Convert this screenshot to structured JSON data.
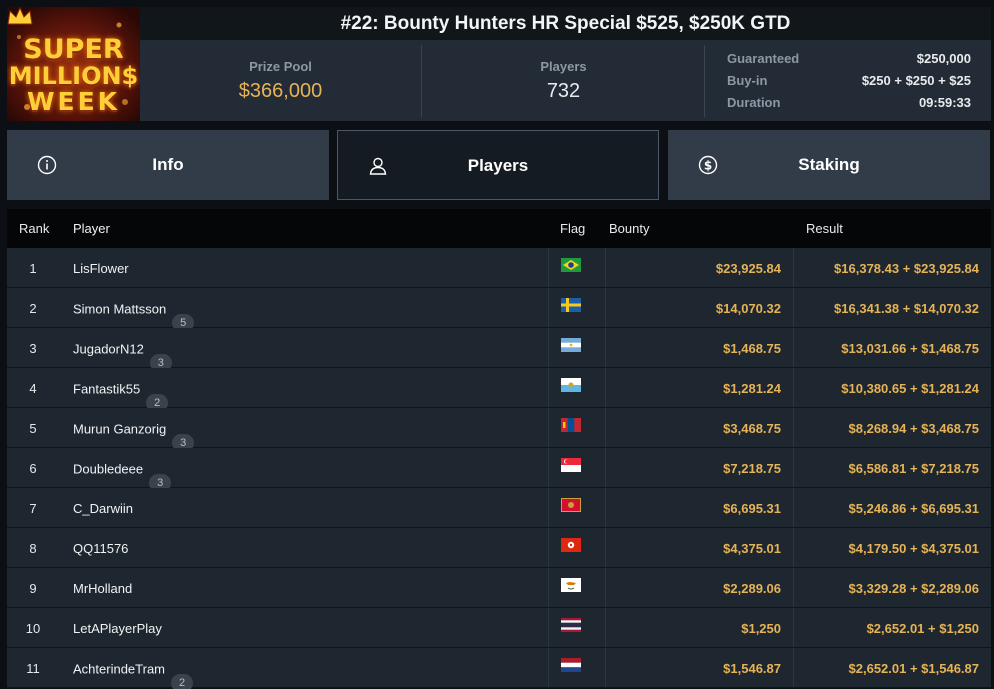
{
  "logo": {
    "line1": "SUPER",
    "line2": "MILLION$",
    "line3": "WEEK"
  },
  "header": {
    "title": "#22: Bounty Hunters HR Special $525, $250K GTD",
    "prize_pool_label": "Prize Pool",
    "prize_pool_value": "$366,000",
    "players_label": "Players",
    "players_value": "732",
    "details": [
      {
        "label": "Guaranteed",
        "value": "$250,000"
      },
      {
        "label": "Buy-in",
        "value": "$250 + $250 + $25"
      },
      {
        "label": "Duration",
        "value": "09:59:33"
      }
    ]
  },
  "tabs": [
    {
      "label": "Info",
      "icon": "info-icon"
    },
    {
      "label": "Players",
      "icon": "user-icon",
      "active": true
    },
    {
      "label": "Staking",
      "icon": "dollar-coin-icon"
    }
  ],
  "table": {
    "headers": {
      "rank": "Rank",
      "player": "Player",
      "flag": "Flag",
      "bounty": "Bounty",
      "result": "Result"
    },
    "rows": [
      {
        "rank": "1",
        "player": "LisFlower",
        "badge": "",
        "flag": "brazil",
        "bounty": "$23,925.84",
        "result": "$16,378.43 + $23,925.84"
      },
      {
        "rank": "2",
        "player": "Simon Mattsson",
        "badge": "5",
        "flag": "sweden",
        "bounty": "$14,070.32",
        "result": "$16,341.38 + $14,070.32"
      },
      {
        "rank": "3",
        "player": "JugadorN12",
        "badge": "3",
        "flag": "argentina",
        "bounty": "$1,468.75",
        "result": "$13,031.66 + $1,468.75"
      },
      {
        "rank": "4",
        "player": "Fantastik55",
        "badge": "2",
        "flag": "san-marino",
        "bounty": "$1,281.24",
        "result": "$10,380.65 + $1,281.24"
      },
      {
        "rank": "5",
        "player": "Murun Ganzorig",
        "badge": "3",
        "flag": "mongolia",
        "bounty": "$3,468.75",
        "result": "$8,268.94 + $3,468.75"
      },
      {
        "rank": "6",
        "player": "Doubledeee",
        "badge": "3",
        "flag": "singapore",
        "bounty": "$7,218.75",
        "result": "$6,586.81 + $7,218.75"
      },
      {
        "rank": "7",
        "player": "C_Darwiin",
        "badge": "",
        "flag": "montenegro",
        "bounty": "$6,695.31",
        "result": "$5,246.86 + $6,695.31"
      },
      {
        "rank": "8",
        "player": "QQ11576",
        "badge": "",
        "flag": "hong-kong",
        "bounty": "$4,375.01",
        "result": "$4,179.50 + $4,375.01"
      },
      {
        "rank": "9",
        "player": "MrHolland",
        "badge": "",
        "flag": "cyprus",
        "bounty": "$2,289.06",
        "result": "$3,329.28 + $2,289.06"
      },
      {
        "rank": "10",
        "player": "LetAPlayerPlay",
        "badge": "",
        "flag": "thailand",
        "bounty": "$1,250",
        "result": "$2,652.01 + $1,250"
      },
      {
        "rank": "11",
        "player": "AchterindeTram",
        "badge": "2",
        "flag": "netherlands",
        "bounty": "$1,546.87",
        "result": "$2,652.01 + $1,546.87"
      }
    ]
  },
  "colors": {
    "gold": "#e6b356",
    "panel": "#222b36",
    "row": "#1e2730",
    "tab": "#323c48"
  }
}
